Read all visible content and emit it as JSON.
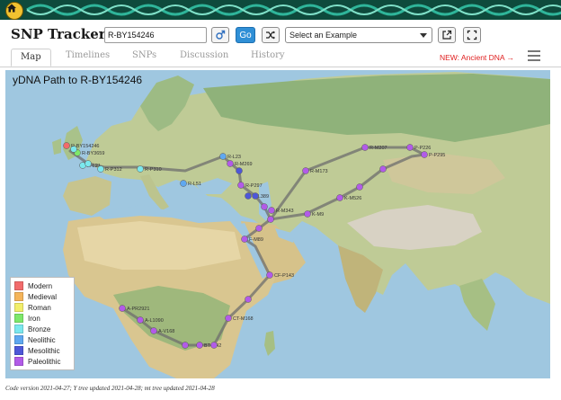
{
  "app": {
    "title": "SNP Tracker"
  },
  "search": {
    "value": "R-BY154246",
    "go_label": "Go"
  },
  "example_select": {
    "selected": "Select an Example"
  },
  "icons": {
    "home": "home-icon",
    "male": "male-icon",
    "shuffle": "shuffle-icon",
    "external": "external-link-icon",
    "fullscreen": "fullscreen-icon",
    "menu": "hamburger-menu-icon"
  },
  "tabs": [
    {
      "label": "Map",
      "active": true
    },
    {
      "label": "Timelines",
      "active": false
    },
    {
      "label": "SNPs",
      "active": false
    },
    {
      "label": "Discussion",
      "active": false
    },
    {
      "label": "History",
      "active": false
    }
  ],
  "ancient_link": "NEW: Ancient DNA →",
  "map": {
    "title": "yDNA Path to R-BY154246",
    "legend": [
      {
        "label": "Modern",
        "color": "#f26b6b"
      },
      {
        "label": "Medieval",
        "color": "#f5b45a"
      },
      {
        "label": "Roman",
        "color": "#f2ee6a"
      },
      {
        "label": "Iron",
        "color": "#7ee86a"
      },
      {
        "label": "Bronze",
        "color": "#7be8ee"
      },
      {
        "label": "Neolithic",
        "color": "#5fa8f0"
      },
      {
        "label": "Mesolithic",
        "color": "#4e57d8"
      },
      {
        "label": "Paleolithic",
        "color": "#b25be8"
      }
    ],
    "nodes": [
      {
        "label": "R-BY154246"
      },
      {
        "label": "R-BY3659"
      },
      {
        "label": "R-L21"
      },
      {
        "label": "R-P312"
      },
      {
        "label": "R-P310"
      },
      {
        "label": "R-L51"
      },
      {
        "label": "R-L23"
      },
      {
        "label": "R-M269"
      },
      {
        "label": "R-P297"
      },
      {
        "label": "R-L389"
      },
      {
        "label": "R-M343"
      },
      {
        "label": "R-M173"
      },
      {
        "label": "R-M207"
      },
      {
        "label": "P-P226"
      },
      {
        "label": "P-P295"
      },
      {
        "label": "K-M526"
      },
      {
        "label": "K-M9"
      },
      {
        "label": "F-M89"
      },
      {
        "label": "CT-M168"
      },
      {
        "label": "CF-P143"
      },
      {
        "label": "A-PR2921"
      },
      {
        "label": "A-L1090"
      },
      {
        "label": "A-V168"
      },
      {
        "label": "BT-M42"
      }
    ]
  },
  "footer": "Code version 2021-04-27; Y tree updated 2021-04-28; mt tree updated 2021-04-28"
}
